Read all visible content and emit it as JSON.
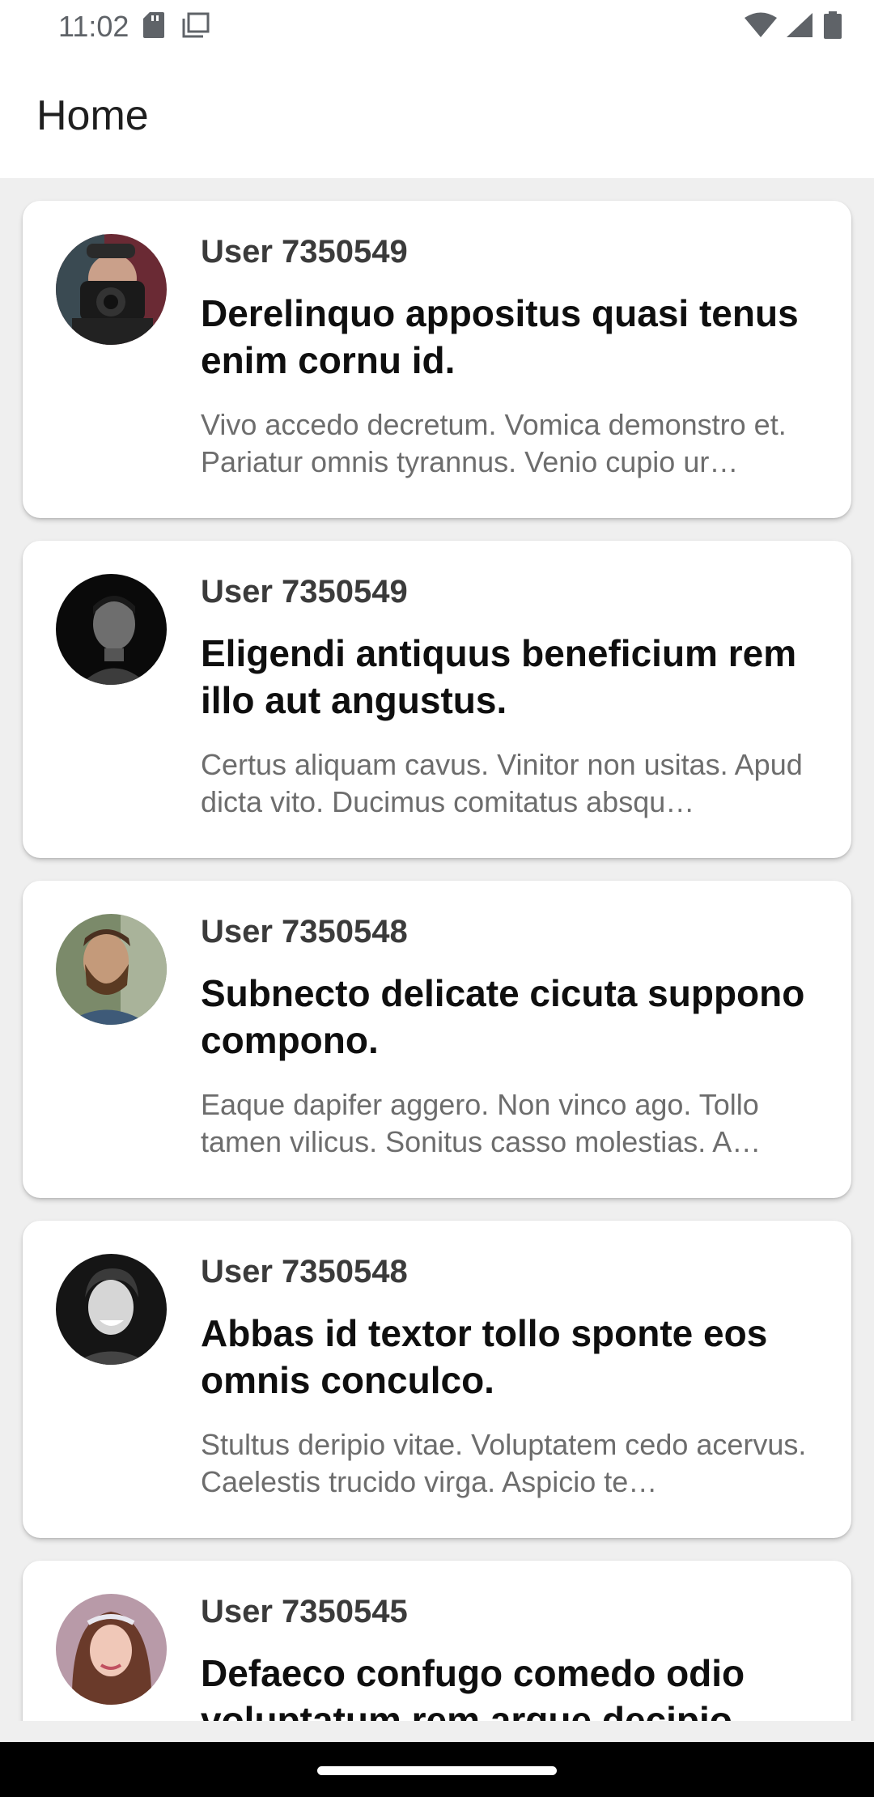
{
  "status_bar": {
    "time": "11:02",
    "icons": [
      "sd-card-icon",
      "screenshot-icon",
      "wifi-icon",
      "signal-icon",
      "battery-icon"
    ]
  },
  "app_bar": {
    "title": "Home"
  },
  "posts": [
    {
      "user": "User 7350549",
      "title": "Derelinquo appositus quasi tenus enim cornu id.",
      "body": "Vivo accedo decretum. Vomica demonstro et. Pariatur omnis tyrannus. Venio cupio ur…",
      "avatar": "avatar-photographer"
    },
    {
      "user": "User 7350549",
      "title": "Eligendi antiquus beneficium rem illo aut angustus.",
      "body": "Certus aliquam cavus. Vinitor non usitas. Apud dicta vito. Ducimus comitatus absqu…",
      "avatar": "avatar-dark-portrait"
    },
    {
      "user": "User 7350548",
      "title": "Subnecto delicate cicuta suppono compono.",
      "body": "Eaque dapifer aggero. Non vinco ago. Tollo tamen vilicus. Sonitus casso molestias. A…",
      "avatar": "avatar-bearded-man"
    },
    {
      "user": "User 7350548",
      "title": "Abbas id textor tollo sponte eos omnis conculco.",
      "body": "Stultus deripio vitae. Voluptatem cedo acervus. Caelestis trucido virga. Aspicio te…",
      "avatar": "avatar-smiling-man"
    },
    {
      "user": "User 7350545",
      "title": "Defaeco confugo comedo odio voluptatum rem argue decipio.",
      "body": "",
      "avatar": "avatar-woman"
    }
  ],
  "colors": {
    "background": "#efefef",
    "card": "#ffffff",
    "title_text": "#0f0f0f",
    "user_text": "#3b3b3b",
    "body_text": "#6d6d6d"
  }
}
